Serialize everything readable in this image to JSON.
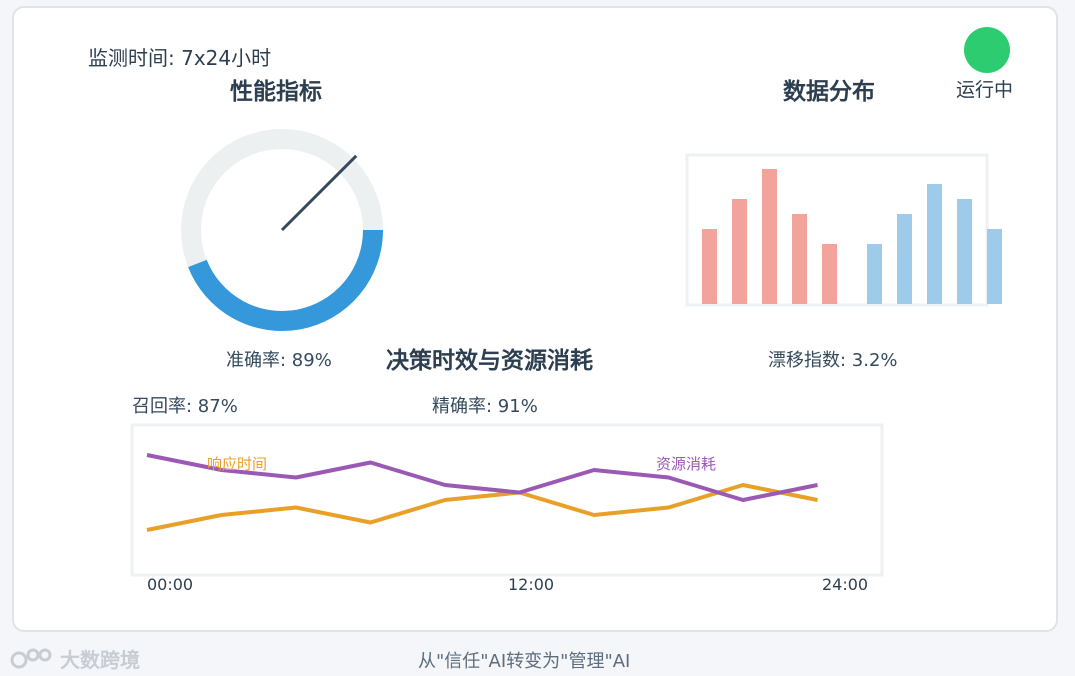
{
  "header": {
    "monitor_label": "监测时间: 7x24小时",
    "status_label": "运行中",
    "status_color": "#2ecc71",
    "status_icon": "status-dot"
  },
  "sections": {
    "performance_title": "性能指标",
    "distribution_title": "数据分布",
    "timeline_title": "决策时效与资源消耗"
  },
  "metrics": {
    "accuracy": "准确率: 89%",
    "drift": "漂移指数: 3.2%",
    "recall": "召回率: 87%",
    "precision": "精确率: 91%"
  },
  "footer": {
    "watermark": "大数跨境",
    "caption": "从\"信任\"AI转变为\"管理\"AI"
  },
  "chart_data": [
    {
      "type": "gauge",
      "value": 0.75,
      "needle_angle_deg": 45,
      "colors": {
        "fill": "#3498db",
        "track": "#ecf0f1",
        "needle": "#34495e"
      }
    },
    {
      "type": "bar",
      "groups": [
        {
          "color": "#f1a39c",
          "values": [
            5,
            7,
            9,
            6,
            4
          ]
        },
        {
          "color": "#9ecbea",
          "values": [
            4,
            6,
            8,
            7,
            5
          ]
        }
      ],
      "ylim": [
        0,
        10
      ]
    },
    {
      "type": "line",
      "x_ticks": [
        "00:00",
        "12:00",
        "24:00"
      ],
      "x": [
        0,
        2,
        4,
        6,
        8,
        10,
        12,
        14,
        16,
        18,
        20
      ],
      "series": [
        {
          "name": "响应时间",
          "color": "#e8a027",
          "values": [
            3,
            4,
            4.5,
            3.5,
            5,
            5.5,
            4,
            4.5,
            6,
            5
          ]
        },
        {
          "name": "资源消耗",
          "color": "#9b59b6",
          "values": [
            8,
            7,
            6.5,
            7.5,
            6,
            5.5,
            7,
            6.5,
            5,
            6
          ]
        }
      ],
      "ylim": [
        0,
        10
      ]
    }
  ]
}
